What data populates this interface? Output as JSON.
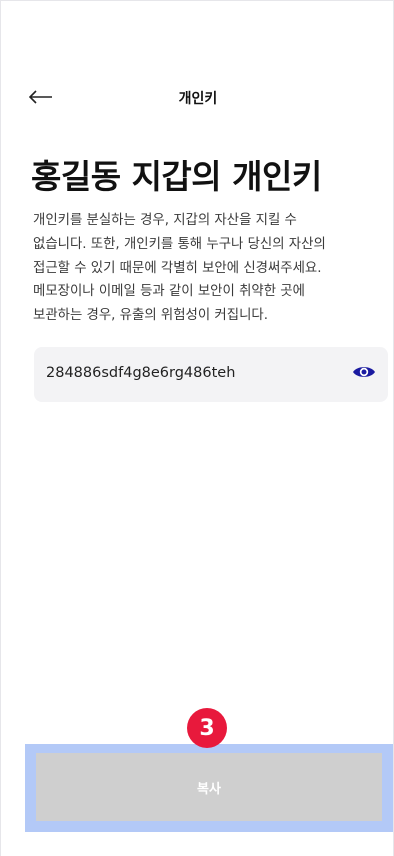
{
  "header": {
    "title": "개인키",
    "back_icon": "arrow-left-icon"
  },
  "main": {
    "title": "홍길동 지갑의 개인키",
    "description_lines": [
      "개인키를 분실하는 경우, 지갑의 자산을 지킬 수",
      "없습니다. 또한, 개인키를 통해 누구나 당신의 자산의",
      "접근할 수 있기 때문에 각별히 보안에 신경써주세요.",
      "메모장이나 이메일 등과 같이 보안이 취약한 곳에",
      "보관하는 경우, 유출의 위험성이 커집니다."
    ],
    "private_key": "284886sdf4g8e6rg486teh",
    "eye_icon": "eye-icon"
  },
  "footer": {
    "copy_label": "복사",
    "step_badge": "3"
  },
  "colors": {
    "eye_icon": "#1a1aa0",
    "button_disabled": "#cfcfcf",
    "highlight": "#b3c9f7",
    "badge": "#e8193c"
  }
}
